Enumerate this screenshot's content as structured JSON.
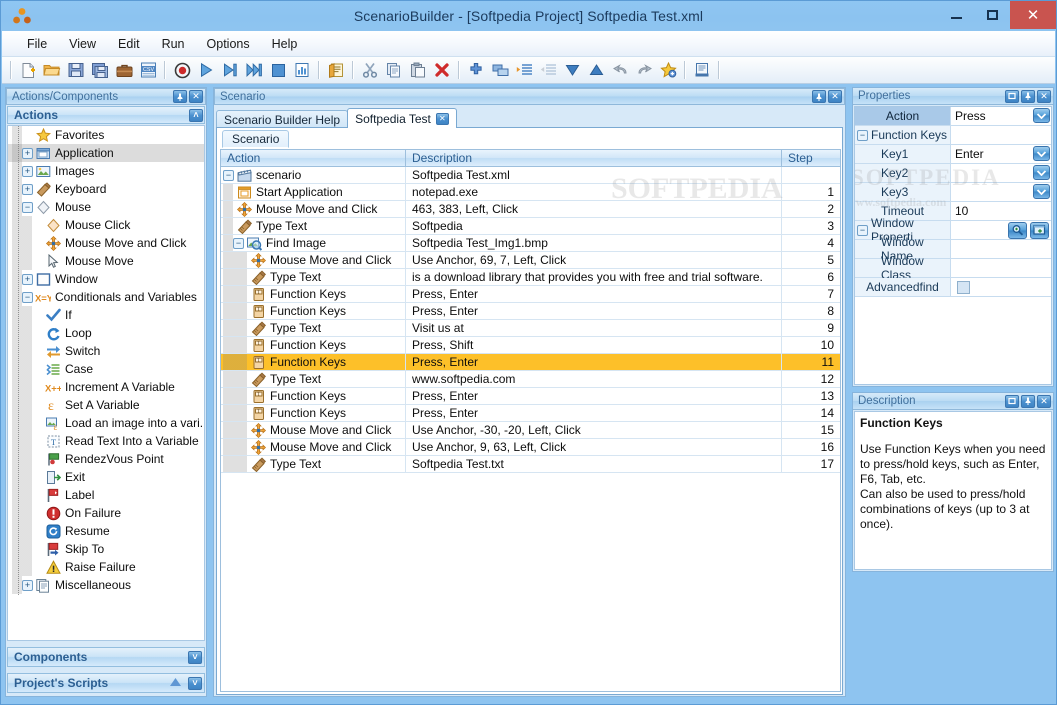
{
  "window": {
    "title": "ScenarioBuilder - [Softpedia Project] Softpedia Test.xml",
    "logo_icon": "scenariobuilder-logo-icon",
    "minimize_label": "Minimize",
    "maximize_label": "Maximize",
    "close_label": "✕"
  },
  "menu": {
    "items": [
      {
        "label": "File"
      },
      {
        "label": "View"
      },
      {
        "label": "Edit"
      },
      {
        "label": "Run"
      },
      {
        "label": "Options"
      },
      {
        "label": "Help"
      }
    ]
  },
  "toolbar": {
    "groups": [
      {
        "buttons": [
          {
            "name": "new-file-icon",
            "label": "New"
          },
          {
            "name": "open-folder-icon",
            "label": "Open"
          },
          {
            "name": "save-icon",
            "label": "Save"
          },
          {
            "name": "save-all-icon",
            "label": "Save All"
          },
          {
            "name": "briefcase-icon",
            "label": "Project"
          },
          {
            "name": "csv-export-icon",
            "label": "CSV"
          }
        ]
      },
      {
        "buttons": [
          {
            "name": "record-icon",
            "label": "Record"
          },
          {
            "name": "play-icon",
            "label": "Run"
          },
          {
            "name": "step-over-icon",
            "label": "Step"
          },
          {
            "name": "step-into-icon",
            "label": "Step Into"
          },
          {
            "name": "stop-icon",
            "label": "Stop"
          },
          {
            "name": "report-chart-icon",
            "label": "Report"
          }
        ]
      },
      {
        "buttons": [
          {
            "name": "script-edit-icon",
            "label": "Edit Script"
          }
        ]
      },
      {
        "buttons": [
          {
            "name": "cut-icon",
            "label": "Cut"
          },
          {
            "name": "copy-icon",
            "label": "Copy"
          },
          {
            "name": "paste-icon",
            "label": "Paste"
          },
          {
            "name": "delete-icon",
            "label": "Delete"
          }
        ]
      },
      {
        "buttons": [
          {
            "name": "add-icon",
            "label": "Add"
          },
          {
            "name": "duplicate-icon",
            "label": "Duplicate"
          },
          {
            "name": "indent-icon",
            "label": "Indent"
          },
          {
            "name": "outdent-icon",
            "label": "Outdent"
          },
          {
            "name": "move-down-icon",
            "label": "Move Down"
          },
          {
            "name": "move-up-icon",
            "label": "Move Up"
          },
          {
            "name": "undo-icon",
            "label": "Undo"
          },
          {
            "name": "redo-icon",
            "label": "Redo"
          },
          {
            "name": "favorite-star-icon",
            "label": "Favorite"
          }
        ]
      },
      {
        "buttons": [
          {
            "name": "log-scroll-icon",
            "label": "Log"
          }
        ]
      }
    ]
  },
  "left_dock": {
    "caption": "Actions/Components",
    "caption_buttons": [
      {
        "name": "pin-button",
        "glyph": "□"
      },
      {
        "name": "close-button",
        "glyph": "✕"
      }
    ],
    "section_title": "Actions",
    "section_collapse_glyph": "˄",
    "tree": [
      {
        "label": "Favorites",
        "icon": "star-icon",
        "depth": 1,
        "expander": "none",
        "selected": false
      },
      {
        "label": "Application",
        "icon": "application-icon",
        "depth": 1,
        "expander": "plus",
        "selected": true
      },
      {
        "label": "Images",
        "icon": "images-icon",
        "depth": 1,
        "expander": "plus",
        "selected": false
      },
      {
        "label": "Keyboard",
        "icon": "keyboard-icon",
        "depth": 1,
        "expander": "plus",
        "selected": false
      },
      {
        "label": "Mouse",
        "icon": "mouse-icon",
        "depth": 1,
        "expander": "minus",
        "selected": false
      },
      {
        "label": "Mouse Click",
        "icon": "mouse-click-icon",
        "depth": 2,
        "expander": "none",
        "selected": false
      },
      {
        "label": "Mouse Move and Click",
        "icon": "move-click-icon",
        "depth": 2,
        "expander": "none",
        "selected": false
      },
      {
        "label": "Mouse Move",
        "icon": "cursor-arrow-icon",
        "depth": 2,
        "expander": "none",
        "selected": false
      },
      {
        "label": "Window",
        "icon": "window-icon",
        "depth": 1,
        "expander": "plus",
        "selected": false
      },
      {
        "label": "Conditionals and Variables",
        "icon": "xy-variable-icon",
        "depth": 1,
        "expander": "minus",
        "selected": false
      },
      {
        "label": "If",
        "icon": "checkmark-icon",
        "depth": 2,
        "expander": "none",
        "selected": false
      },
      {
        "label": "Loop",
        "icon": "loop-icon",
        "depth": 2,
        "expander": "none",
        "selected": false
      },
      {
        "label": "Switch",
        "icon": "switch-icon",
        "depth": 2,
        "expander": "none",
        "selected": false
      },
      {
        "label": "Case",
        "icon": "case-icon",
        "depth": 2,
        "expander": "none",
        "selected": false
      },
      {
        "label": "Increment A Variable",
        "icon": "increment-icon",
        "depth": 2,
        "expander": "none",
        "selected": false
      },
      {
        "label": "Set A Variable",
        "icon": "set-variable-icon",
        "depth": 2,
        "expander": "none",
        "selected": false
      },
      {
        "label": "Load an image into a vari...",
        "icon": "load-image-icon",
        "depth": 2,
        "expander": "none",
        "selected": false
      },
      {
        "label": "Read Text Into a Variable",
        "icon": "read-text-icon",
        "depth": 2,
        "expander": "none",
        "selected": false
      },
      {
        "label": "RendezVous Point",
        "icon": "rendezvous-flag-icon",
        "depth": 2,
        "expander": "none",
        "selected": false
      },
      {
        "label": "Exit",
        "icon": "exit-icon",
        "depth": 2,
        "expander": "none",
        "selected": false
      },
      {
        "label": "Label",
        "icon": "label-flag-icon",
        "depth": 2,
        "expander": "none",
        "selected": false
      },
      {
        "label": "On Failure",
        "icon": "on-failure-icon",
        "depth": 2,
        "expander": "none",
        "selected": false
      },
      {
        "label": "Resume",
        "icon": "resume-icon",
        "depth": 2,
        "expander": "none",
        "selected": false
      },
      {
        "label": "Skip To",
        "icon": "skip-to-icon",
        "depth": 2,
        "expander": "none",
        "selected": false
      },
      {
        "label": "Raise Failure",
        "icon": "warning-icon",
        "depth": 2,
        "expander": "none",
        "selected": false
      },
      {
        "label": "Miscellaneous",
        "icon": "miscellaneous-icon",
        "depth": 1,
        "expander": "plus",
        "selected": false
      }
    ],
    "collapsed_sections": [
      {
        "label": "Components",
        "glyph": "˅",
        "has_up": false
      },
      {
        "label": "Project's Scripts",
        "glyph": "˅",
        "has_up": true
      }
    ]
  },
  "center_dock": {
    "caption": "Scenario",
    "caption_buttons": [
      {
        "name": "pin-button",
        "glyph": "□"
      },
      {
        "name": "close-button",
        "glyph": "✕"
      }
    ],
    "tabs": [
      {
        "label": "Scenario Builder Help",
        "active": false,
        "closable": false
      },
      {
        "label": "Softpedia Test",
        "active": true,
        "closable": true,
        "close_glyph": "✕"
      }
    ],
    "subtabs": [
      {
        "label": "Scenario",
        "active": true
      }
    ],
    "grid": {
      "columns": [
        {
          "key": "action",
          "label": "Action"
        },
        {
          "key": "description",
          "label": "Description"
        },
        {
          "key": "step",
          "label": "Step"
        }
      ],
      "rows": [
        {
          "action": "scenario",
          "description": "Softpedia Test.xml",
          "step": "",
          "depth": 0,
          "icon": "scenario-clapboard-icon",
          "expander": "minus",
          "highlighted": false
        },
        {
          "action": "Start Application",
          "description": "notepad.exe",
          "step": "1",
          "depth": 1,
          "icon": "start-application-icon",
          "expander": "none",
          "highlighted": false
        },
        {
          "action": "Mouse Move and Click",
          "description": "463, 383, Left, Click",
          "step": "2",
          "depth": 1,
          "icon": "move-click-icon",
          "expander": "none",
          "highlighted": false
        },
        {
          "action": "Type Text",
          "description": "Softpedia",
          "step": "3",
          "depth": 1,
          "icon": "type-text-icon",
          "expander": "none",
          "highlighted": false
        },
        {
          "action": "Find Image",
          "description": "Softpedia Test_Img1.bmp",
          "step": "4",
          "depth": 1,
          "icon": "find-image-icon",
          "expander": "minus",
          "highlighted": false
        },
        {
          "action": "Mouse Move and Click",
          "description": "Use Anchor, 69, 7, Left, Click",
          "step": "5",
          "depth": 2,
          "icon": "move-click-icon",
          "expander": "none",
          "highlighted": false
        },
        {
          "action": "Type Text",
          "description": "is a download library that provides you with free and trial software.",
          "step": "6",
          "depth": 2,
          "icon": "type-text-icon",
          "expander": "none",
          "highlighted": false
        },
        {
          "action": "Function Keys",
          "description": "Press, Enter",
          "step": "7",
          "depth": 2,
          "icon": "function-keys-icon",
          "expander": "none",
          "highlighted": false
        },
        {
          "action": "Function Keys",
          "description": "Press, Enter",
          "step": "8",
          "depth": 2,
          "icon": "function-keys-icon",
          "expander": "none",
          "highlighted": false
        },
        {
          "action": "Type Text",
          "description": "Visit us at",
          "step": "9",
          "depth": 2,
          "icon": "type-text-icon",
          "expander": "none",
          "highlighted": false
        },
        {
          "action": "Function Keys",
          "description": "Press, Shift",
          "step": "10",
          "depth": 2,
          "icon": "function-keys-icon",
          "expander": "none",
          "highlighted": false
        },
        {
          "action": "Function Keys",
          "description": "Press, Enter",
          "step": "11",
          "depth": 2,
          "icon": "function-keys-icon",
          "expander": "none",
          "highlighted": true
        },
        {
          "action": "Type Text",
          "description": "www.softpedia.com",
          "step": "12",
          "depth": 2,
          "icon": "type-text-icon",
          "expander": "none",
          "highlighted": false
        },
        {
          "action": "Function Keys",
          "description": "Press, Enter",
          "step": "13",
          "depth": 2,
          "icon": "function-keys-icon",
          "expander": "none",
          "highlighted": false
        },
        {
          "action": "Function Keys",
          "description": "Press, Enter",
          "step": "14",
          "depth": 2,
          "icon": "function-keys-icon",
          "expander": "none",
          "highlighted": false
        },
        {
          "action": "Mouse Move and Click",
          "description": "Use Anchor, -30, -20, Left, Click",
          "step": "15",
          "depth": 2,
          "icon": "move-click-icon",
          "expander": "none",
          "highlighted": false
        },
        {
          "action": "Mouse Move and Click",
          "description": "Use Anchor, 9, 63, Left, Click",
          "step": "16",
          "depth": 2,
          "icon": "move-click-icon",
          "expander": "none",
          "highlighted": false
        },
        {
          "action": "Type Text",
          "description": "Softpedia Test.txt",
          "step": "17",
          "depth": 2,
          "icon": "type-text-icon",
          "expander": "none",
          "highlighted": false
        }
      ]
    }
  },
  "properties": {
    "caption": "Properties",
    "caption_buttons": [
      {
        "name": "restore-button",
        "glyph": "□"
      },
      {
        "name": "pin-button",
        "glyph": "□"
      },
      {
        "name": "close-button",
        "glyph": "✕"
      }
    ],
    "rows": [
      {
        "name": "Action",
        "value": "Press",
        "kind": "combo",
        "selected": true,
        "indent": "center"
      },
      {
        "name": "Function Keys",
        "value": "",
        "kind": "group",
        "selected": false,
        "indent": "group",
        "expander": "minus"
      },
      {
        "name": "Key1",
        "value": "Enter",
        "kind": "combo",
        "selected": false,
        "indent": "deep"
      },
      {
        "name": "Key2",
        "value": "",
        "kind": "combo",
        "selected": false,
        "indent": "deep"
      },
      {
        "name": "Key3",
        "value": "",
        "kind": "combo",
        "selected": false,
        "indent": "deep"
      },
      {
        "name": "Timeout",
        "value": "10",
        "kind": "text",
        "selected": false,
        "indent": "center"
      },
      {
        "name": "Window Properti",
        "value": "",
        "kind": "buttons",
        "selected": false,
        "indent": "group",
        "expander": "minus"
      },
      {
        "name": "Window Name",
        "value": "",
        "kind": "text",
        "selected": false,
        "indent": "right"
      },
      {
        "name": "Window Class",
        "value": "",
        "kind": "text",
        "selected": false,
        "indent": "right"
      },
      {
        "name": "Advancedfind",
        "value": "",
        "kind": "checkbox",
        "selected": false,
        "indent": "center"
      }
    ],
    "action_buttons": [
      {
        "name": "find-window-icon",
        "glyph": "⚲"
      },
      {
        "name": "capture-window-icon",
        "glyph": "⊞"
      }
    ]
  },
  "description": {
    "caption": "Description",
    "caption_buttons": [
      {
        "name": "restore-button",
        "glyph": "□"
      },
      {
        "name": "pin-button",
        "glyph": "□"
      },
      {
        "name": "close-button",
        "glyph": "✕"
      }
    ],
    "title": "Function Keys",
    "body_line1": "Use Function Keys when you need to press/hold keys, such as Enter, F6, Tab, etc.",
    "body_line2": "Can also be used to press/hold combinations of keys (up to 3 at once)."
  },
  "watermarks": {
    "grid_text": "SOFTPEDIA",
    "props_text": "SOFTPEDIA",
    "props_sub": "www.softpedia.com"
  },
  "colors": {
    "titlebar": "#8ec4f0",
    "close_button": "#c9544f",
    "highlight_row": "#fdc029",
    "panel_caption_text": "#41709c",
    "selected_tree": "#dcdcdc"
  }
}
